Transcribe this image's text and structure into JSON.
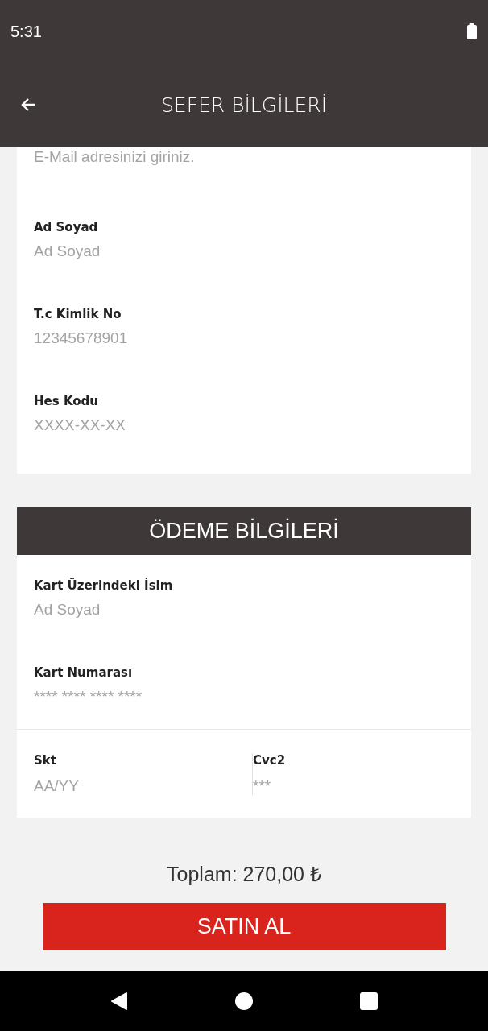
{
  "status_bar": {
    "time": "5:31"
  },
  "app_bar": {
    "title": "SEFER BİLGİLERİ"
  },
  "email_field": {
    "placeholder": "E-Mail adresinizi giriniz."
  },
  "passenger_fields": [
    {
      "label": "Ad Soyad",
      "placeholder": "Ad Soyad"
    },
    {
      "label": "T.c Kimlik No",
      "placeholder": "12345678901"
    },
    {
      "label": "Hes Kodu",
      "placeholder": "XXXX-XX-XX"
    }
  ],
  "payment": {
    "title": "ÖDEME BİLGİLERİ",
    "fields": [
      {
        "label": "Kart Üzerindeki İsim",
        "placeholder": "Ad Soyad"
      },
      {
        "label": "Kart Numarası",
        "placeholder": "**** **** **** ****"
      }
    ],
    "split_fields": [
      {
        "label": "Skt",
        "placeholder": "AA/YY"
      },
      {
        "label": "Cvc2",
        "placeholder": "***"
      }
    ]
  },
  "total": "Toplam: 270,00 ₺",
  "buy_button": "SATIN AL"
}
